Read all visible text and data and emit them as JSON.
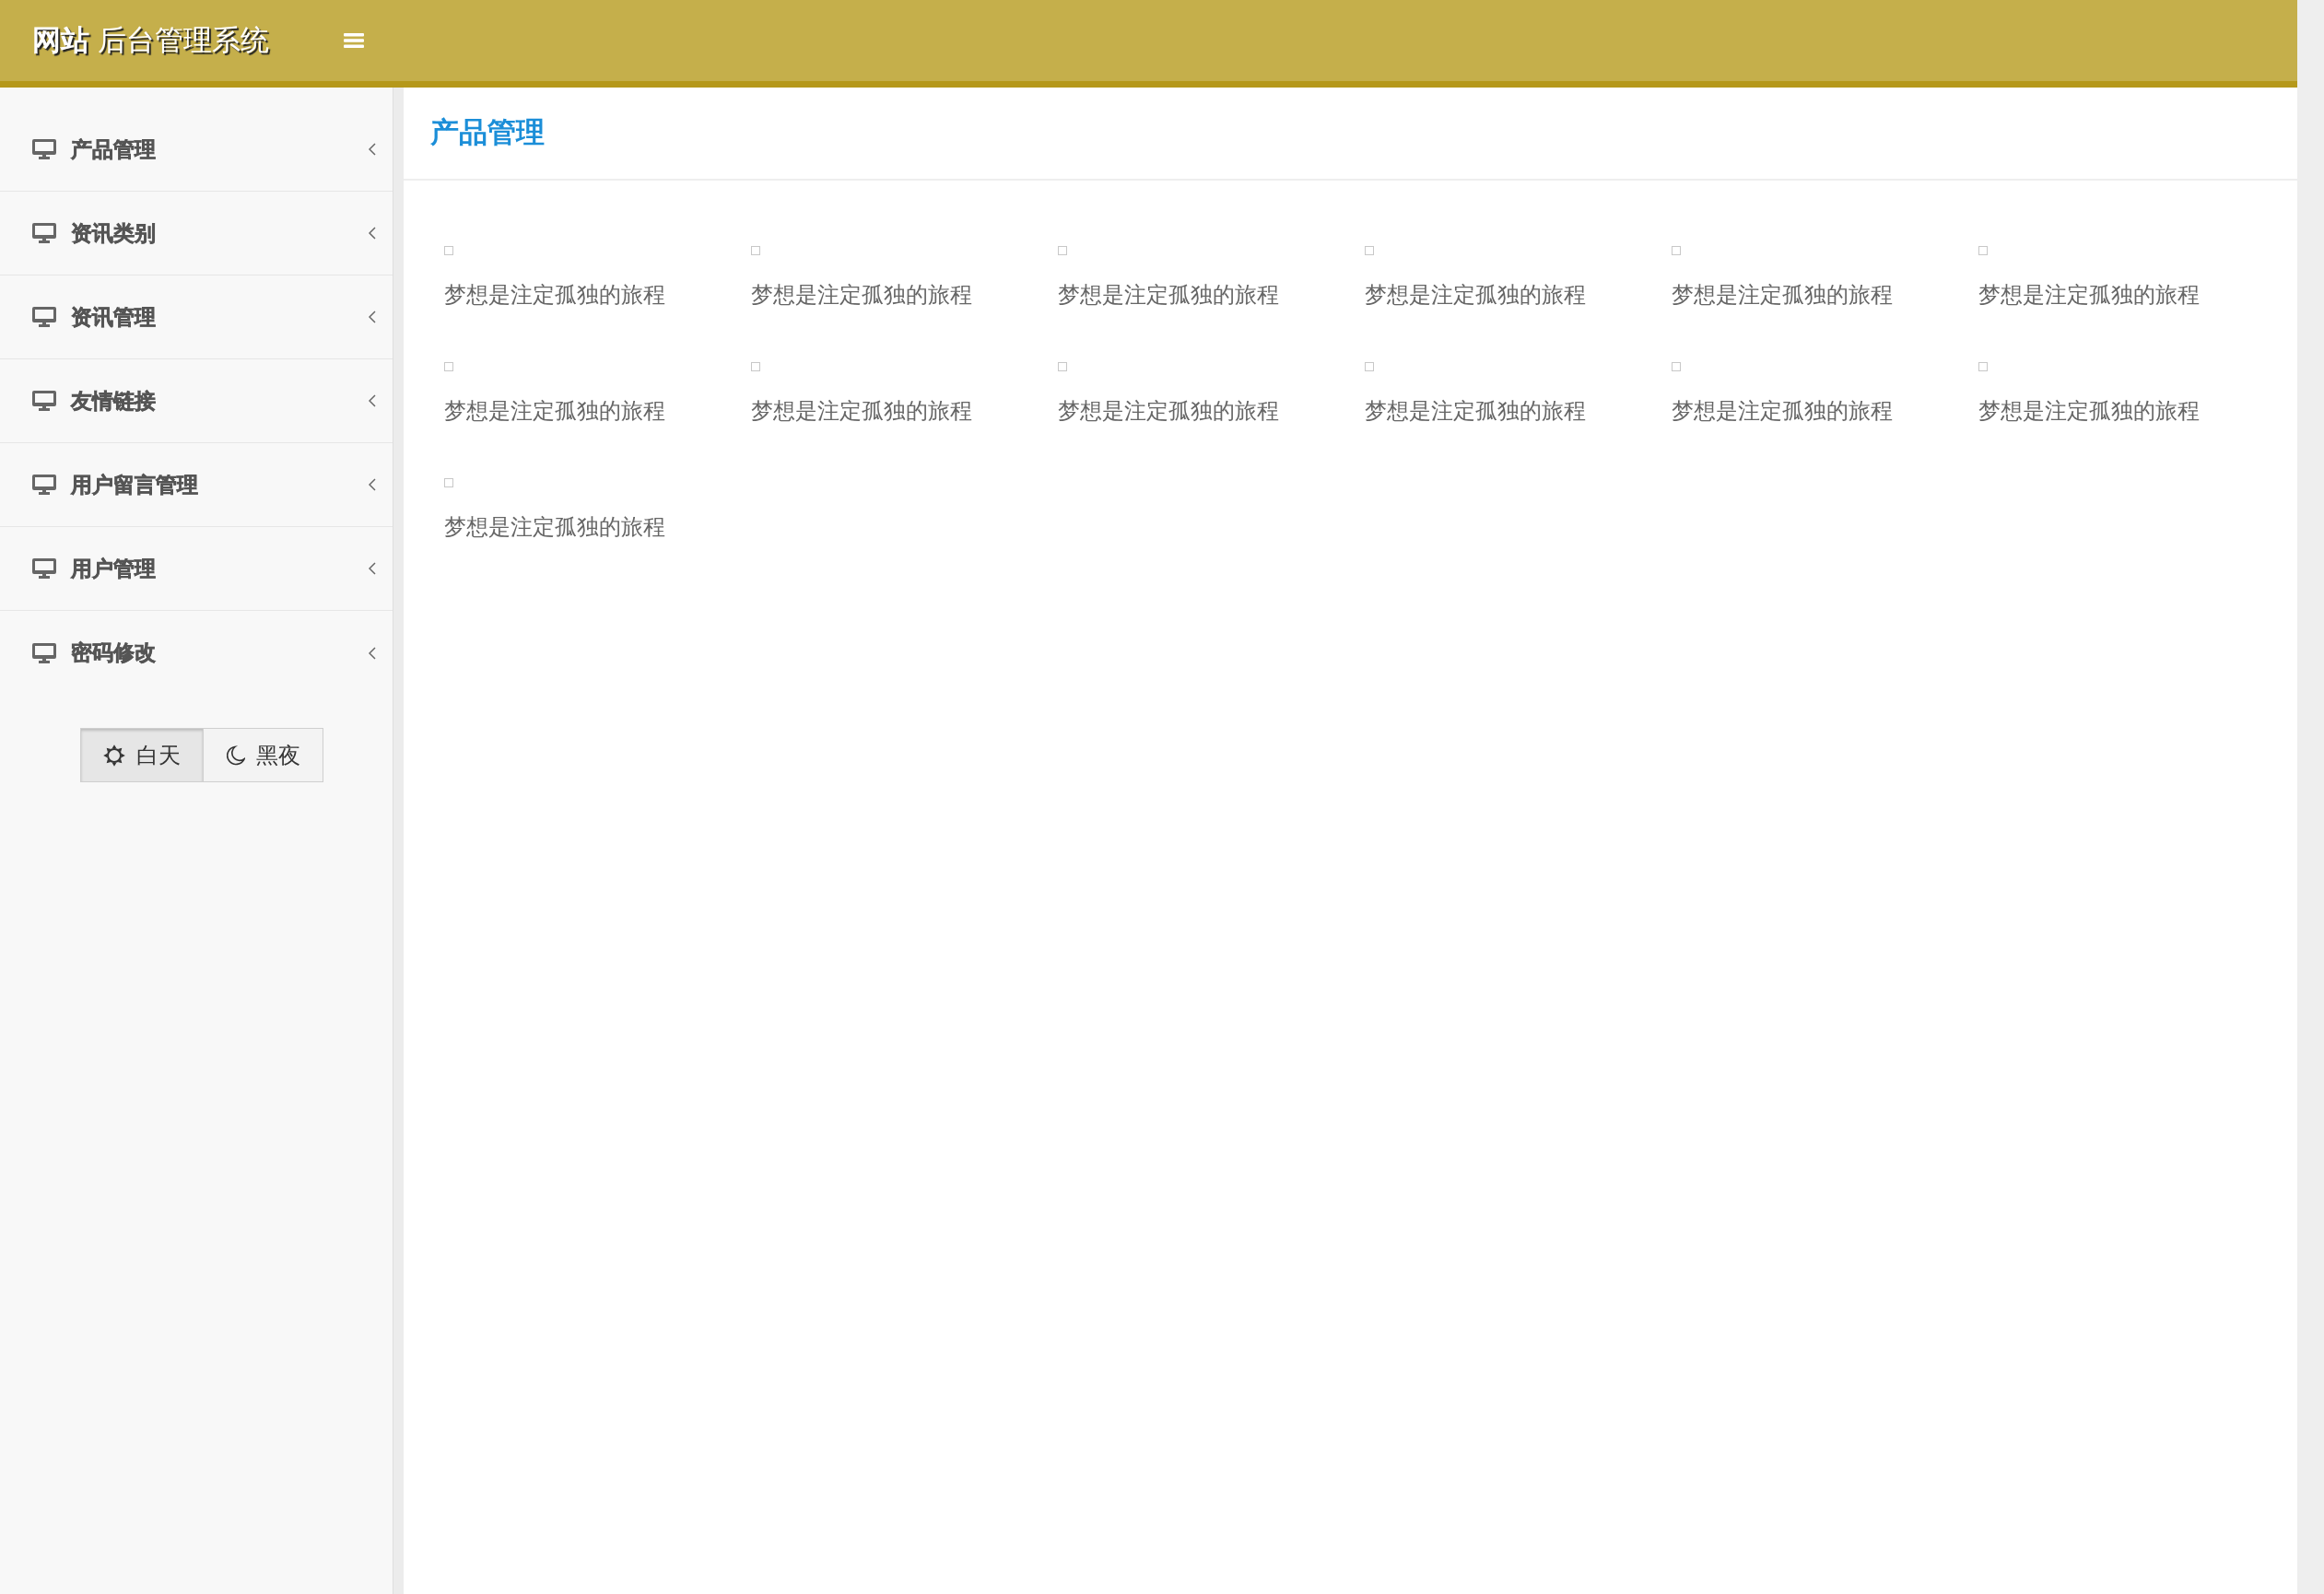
{
  "header": {
    "title": "**网站** 后台管理系统"
  },
  "sidebar": {
    "items": [
      {
        "label": "产品管理",
        "expanded": false
      },
      {
        "label": "资讯类别",
        "expanded": false
      },
      {
        "label": "资讯管理",
        "expanded": false
      },
      {
        "label": "友情链接",
        "expanded": false
      },
      {
        "label": "用户留言管理",
        "expanded": false
      },
      {
        "label": "用户管理",
        "expanded": false
      },
      {
        "label": "密码修改",
        "expanded": false
      }
    ],
    "theme_toggle": [
      {
        "kind": "day",
        "label": "白天",
        "selected": true
      },
      {
        "kind": "night",
        "label": "黑夜",
        "selected": false
      }
    ]
  },
  "page": {
    "title": "产品管理",
    "products": [
      {
        "name": "梦想是注定孤独的旅程"
      },
      {
        "name": "梦想是注定孤独的旅程"
      },
      {
        "name": "梦想是注定孤独的旅程"
      },
      {
        "name": "梦想是注定孤独的旅程"
      },
      {
        "name": "梦想是注定孤独的旅程"
      },
      {
        "name": "梦想是注定孤独的旅程"
      },
      {
        "name": "梦想是注定孤独的旅程"
      },
      {
        "name": "梦想是注定孤独的旅程"
      },
      {
        "name": "梦想是注定孤独的旅程"
      },
      {
        "name": "梦想是注定孤独的旅程"
      },
      {
        "name": "梦想是注定孤独的旅程"
      },
      {
        "name": "梦想是注定孤独的旅程"
      },
      {
        "name": "梦想是注定孤独的旅程"
      }
    ]
  }
}
